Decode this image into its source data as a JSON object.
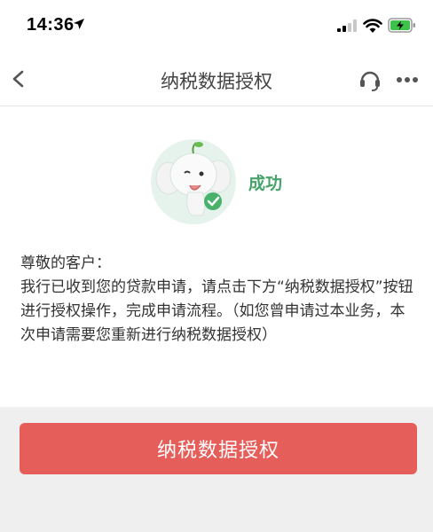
{
  "status_bar": {
    "time": "14:36"
  },
  "nav": {
    "title": "纳税数据授权",
    "back_icon": "chevron-left-icon",
    "support_icon": "headset-icon",
    "more_icon": "more-dots-icon"
  },
  "result": {
    "status_text": "成功",
    "status_color": "#46a36a"
  },
  "message": {
    "greeting": "尊敬的客户：",
    "body": "我行已收到您的贷款申请，请点击下方“纳税数据授权”按钮进行授权操作，完成申请流程。（如您曾申请过本业务，本次申请需要您重新进行纳税数据授权）"
  },
  "action": {
    "button_label": "纳税数据授权",
    "button_color": "#e65e5a"
  }
}
